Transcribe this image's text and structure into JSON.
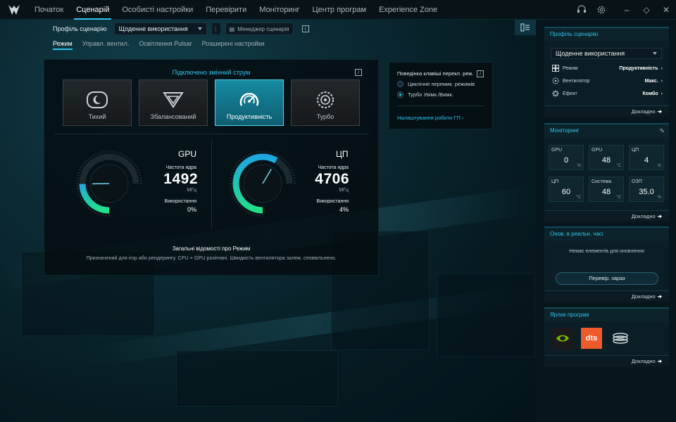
{
  "nav": {
    "tabs": [
      "Початок",
      "Сценарій",
      "Особисті настройки",
      "Перевірити",
      "Моніторинг",
      "Центр програм",
      "Experience Zone"
    ],
    "active": "Сценарій"
  },
  "profile_bar": {
    "label": "Профіль сценарію",
    "selected": "Щоденне використання",
    "manager_label": "Менеджер сценарія"
  },
  "subtabs": [
    "Режим",
    "Управл. вентил.",
    "Освітлення Pulsar",
    "Розширені настройки"
  ],
  "mode_panel": {
    "title": "Підключено змінний струм",
    "modes": [
      {
        "label": "Тихий",
        "icon": "moon-icon"
      },
      {
        "label": "Збалансований",
        "icon": "balance-icon"
      },
      {
        "label": "Продуктивність",
        "icon": "performance-gauge-icon",
        "active": true
      },
      {
        "label": "Турбо",
        "icon": "turbo-fan-icon"
      }
    ],
    "gpu": {
      "name": "GPU",
      "freq_label": "Частота ядра",
      "freq": "1492",
      "unit": "МГц",
      "usage_label": "Використання",
      "usage": "0%",
      "gauge_fraction": 0.33
    },
    "cpu": {
      "name": "ЦП",
      "freq_label": "Частота ядра",
      "freq": "4706",
      "unit": "МГц",
      "usage_label": "Використання",
      "usage": "4%",
      "gauge_fraction": 0.78
    },
    "summary_title": "Загальні відомості про Режим",
    "summary_text": "Призначений для ігор або рендерингу. CPU + GPU розігнані. Швидкість вентилятора залеж. споввільнено."
  },
  "key_panel": {
    "title": "Поведінка клавіші перекл. реж.",
    "options": [
      {
        "label": "Циклічне перемик. режимів",
        "selected": false
      },
      {
        "label": "Турбо Увімк./Вимк.",
        "selected": true
      }
    ],
    "link": "Налаштування роботи ГП ›"
  },
  "right": {
    "more_label": "Докладно",
    "profile": {
      "title": "Профіль сценарію",
      "selected": "Щоденне використання",
      "rows": [
        {
          "label": "Режим",
          "value": "Продуктивність",
          "icon": "mode-grid-icon"
        },
        {
          "label": "Вентилятор",
          "value": "Макс.",
          "icon": "fan-icon"
        },
        {
          "label": "Ефект",
          "value": "Комбо",
          "icon": "effect-icon"
        }
      ]
    },
    "monitoring": {
      "title": "Моніторинг",
      "tiles": [
        {
          "label": "GPU",
          "value": "0",
          "unit": "%"
        },
        {
          "label": "GPU",
          "value": "48",
          "unit": "°C"
        },
        {
          "label": "ЦП",
          "value": "4",
          "unit": "%"
        },
        {
          "label": "ЦП",
          "value": "60",
          "unit": "°C"
        },
        {
          "label": "Система",
          "value": "48",
          "unit": "°C"
        },
        {
          "label": "ОЗП",
          "value": "35.0",
          "unit": "%"
        }
      ]
    },
    "updates": {
      "title": "Онов. в реальн. часі",
      "empty": "Немає елементів для оновлення",
      "button": "Перевір. зараз"
    },
    "shortcuts": {
      "title": "Ярлик програм",
      "apps": [
        "nvidia-icon",
        "dts-icon",
        "coil-icon"
      ],
      "dts_text": "dts"
    }
  },
  "colors": {
    "accent": "#2ec4e8",
    "gauge_blue": "#1fa6e0",
    "gauge_green": "#22e08a",
    "active_mode": "#178ba3"
  }
}
